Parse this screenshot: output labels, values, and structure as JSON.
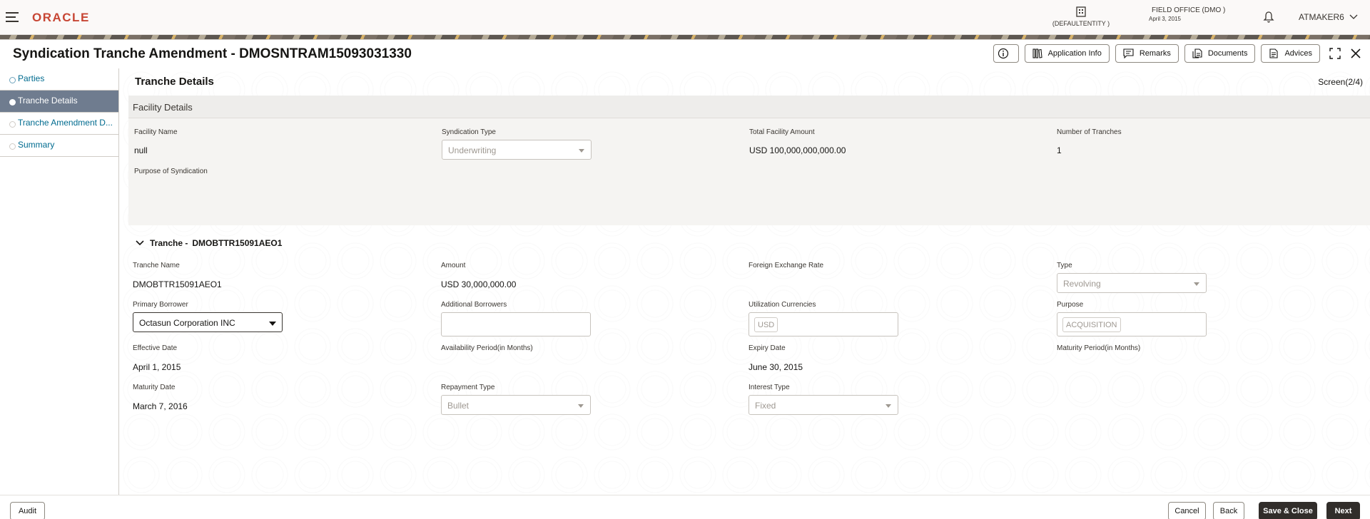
{
  "header": {
    "logo": "ORACLE",
    "entity_label": "(DEFAULTENTITY )",
    "office_line1": "FIELD OFFICE  (DMO )",
    "office_line2": "April 3, 2015",
    "user": "ATMAKER6"
  },
  "window": {
    "title": "Syndication Tranche Amendment - DMOSNTRAM15093031330",
    "buttons": {
      "application_info": "Application Info",
      "remarks": "Remarks",
      "documents": "Documents",
      "advices": "Advices"
    }
  },
  "sidebar": {
    "items": [
      {
        "label": "Parties",
        "state": "completed"
      },
      {
        "label": "Tranche Details",
        "state": "active"
      },
      {
        "label": "Tranche Amendment D...",
        "state": "pending"
      },
      {
        "label": "Summary",
        "state": "pending"
      }
    ]
  },
  "main": {
    "section_title": "Tranche Details",
    "screen_indicator": "Screen(2/4)",
    "facility": {
      "panel_title": "Facility Details",
      "facility_name_label": "Facility Name",
      "facility_name": "null",
      "syndication_type_label": "Syndication Type",
      "syndication_type": "Underwriting",
      "total_amount_label": "Total Facility Amount",
      "total_amount": "USD 100,000,000,000.00",
      "num_tranches_label": "Number of Tranches",
      "num_tranches": "1",
      "purpose_label": "Purpose of Syndication"
    },
    "tranche": {
      "heading": "Tranche -",
      "id": "DMOBTTR15091AEO1",
      "name_label": "Tranche Name",
      "name": "DMOBTTR15091AEO1",
      "amount_label": "Amount",
      "amount": "USD 30,000,000.00",
      "fx_label": "Foreign Exchange Rate",
      "type_label": "Type",
      "type": "Revolving",
      "primary_borrower_label": "Primary Borrower",
      "primary_borrower": "Octasun Corporation INC",
      "additional_borrowers_label": "Additional Borrowers",
      "util_currencies_label": "Utilization Currencies",
      "util_currency": "USD",
      "purpose_label": "Purpose",
      "purpose": "ACQUISITION",
      "effective_date_label": "Effective Date",
      "effective_date": "April 1, 2015",
      "availability_label": "Availability Period(in Months)",
      "expiry_date_label": "Expiry Date",
      "expiry_date": "June 30, 2015",
      "maturity_period_label": "Maturity Period(in Months)",
      "maturity_date_label": "Maturity Date",
      "maturity_date": "March 7, 2016",
      "repayment_type_label": "Repayment Type",
      "repayment_type": "Bullet",
      "interest_type_label": "Interest Type",
      "interest_type": "Fixed"
    }
  },
  "footer": {
    "audit": "Audit",
    "cancel": "Cancel",
    "back": "Back",
    "save_close": "Save & Close",
    "next": "Next"
  },
  "colors": {
    "brand": "#c74634",
    "link": "#006b8f",
    "active_nav": "#6f7c8f",
    "primary_button": "#312d2a"
  }
}
